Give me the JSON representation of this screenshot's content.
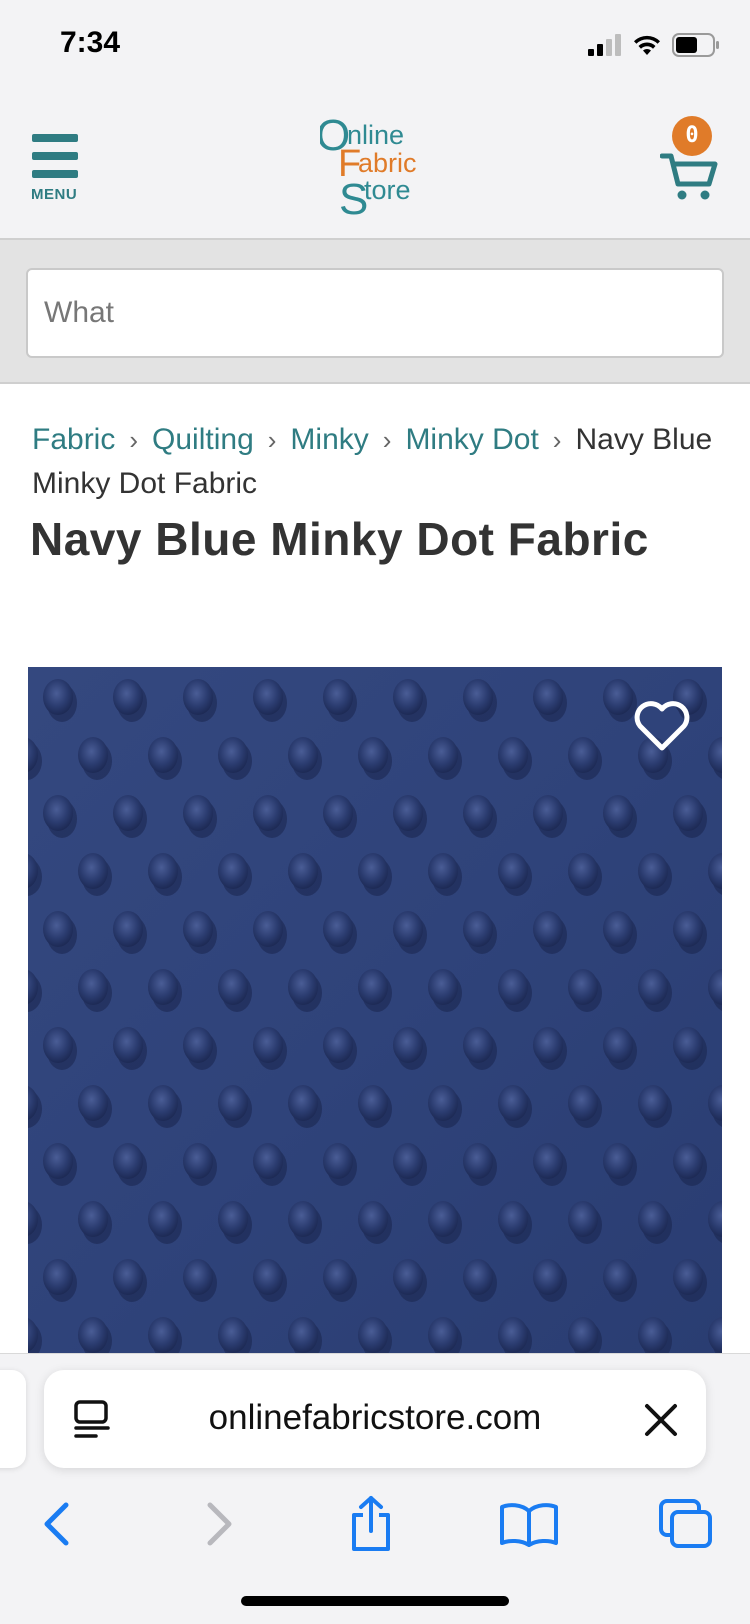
{
  "status_bar": {
    "time": "7:34"
  },
  "header": {
    "menu_label": "MENU",
    "logo": {
      "line1": "Online",
      "line2": "Fabric",
      "line3": "Store"
    },
    "cart_count": "0"
  },
  "search": {
    "placeholder": "What"
  },
  "breadcrumb": {
    "items": [
      "Fabric",
      "Quilting",
      "Minky",
      "Minky Dot"
    ],
    "current": "Navy Blue Minky Dot Fabric",
    "separator": "›"
  },
  "product": {
    "title": "Navy Blue Minky Dot Fabric",
    "fabric_color": "#2f437a"
  },
  "browser": {
    "url": "onlinefabricstore.com"
  },
  "colors": {
    "teal": "#2f7c82",
    "orange": "#e07b29",
    "ios_blue": "#1a7cf2"
  }
}
